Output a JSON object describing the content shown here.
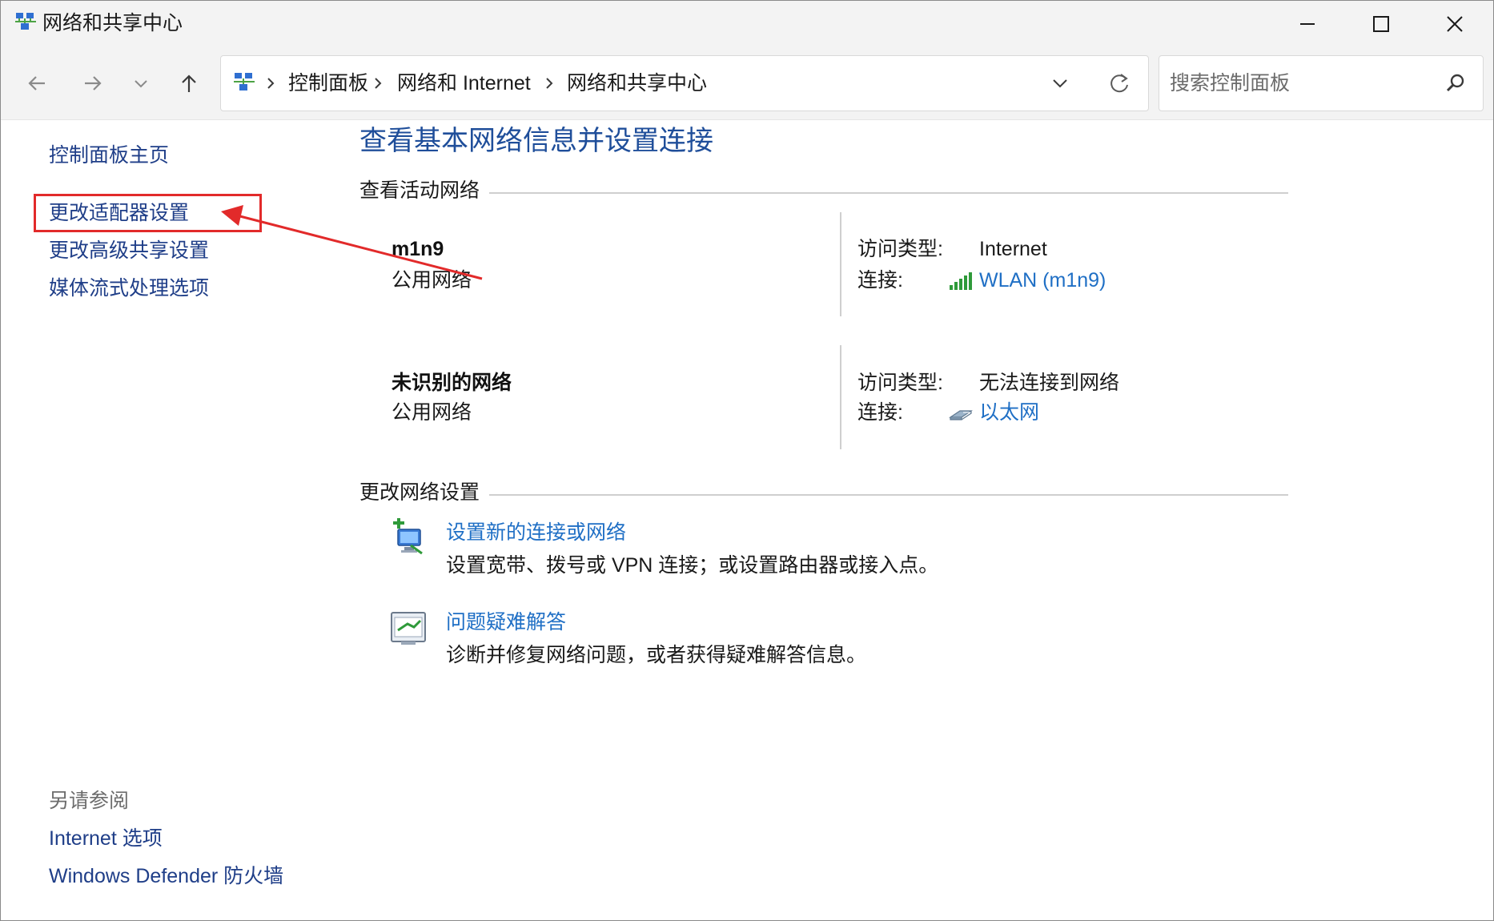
{
  "window": {
    "title": "网络和共享中心"
  },
  "address": {
    "crumbs": [
      "控制面板",
      "网络和 Internet",
      "网络和共享中心"
    ],
    "search_placeholder": "搜索控制面板"
  },
  "sidebar": {
    "home": "控制面板主页",
    "links": [
      "更改适配器设置",
      "更改高级共享设置",
      "媒体流式处理选项"
    ],
    "see_also_heading": "另请参阅",
    "see_also": [
      "Internet 选项",
      "Windows Defender 防火墙"
    ]
  },
  "main": {
    "title": "查看基本网络信息并设置连接",
    "active_networks_heading": "查看活动网络",
    "networks": [
      {
        "name": "m1n9",
        "type": "公用网络",
        "access_label": "访问类型:",
        "access_value": "Internet",
        "connection_label": "连接:",
        "connection_value": "WLAN (m1n9)",
        "connection_icon": "wifi-signal-icon"
      },
      {
        "name": "未识别的网络",
        "type": "公用网络",
        "access_label": "访问类型:",
        "access_value": "无法连接到网络",
        "connection_label": "连接:",
        "connection_value": "以太网",
        "connection_icon": "ethernet-icon"
      }
    ],
    "change_settings_heading": "更改网络设置",
    "tasks": [
      {
        "title": "设置新的连接或网络",
        "desc": "设置宽带、拨号或 VPN 连接；或设置路由器或接入点。",
        "icon": "new-connection-icon"
      },
      {
        "title": "问题疑难解答",
        "desc": "诊断并修复网络问题，或者获得疑难解答信息。",
        "icon": "troubleshoot-icon"
      }
    ]
  },
  "colors": {
    "link": "#1f6fc5",
    "title": "#1f4e9a",
    "annotation": "#e22a2a"
  }
}
